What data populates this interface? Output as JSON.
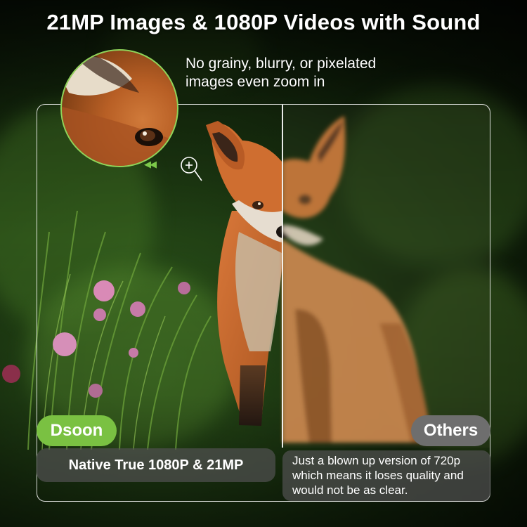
{
  "headline": "21MP Images & 1080P Videos with Sound",
  "subline": [
    "No grainy, blurry, or pixelated",
    "images even zoom in"
  ],
  "labels": {
    "left_brand": "Dsoon",
    "right_brand": "Others",
    "left_caption": "Native True 1080P & 21MP",
    "right_caption": [
      "Just a blown up version of 720p",
      "which means it loses quality and",
      "would not be as clear."
    ]
  },
  "icons": {
    "zoom": "magnifier-plus-icon",
    "arrows": "double-chevron-left-icon"
  },
  "colors": {
    "accent_green": "#7ac142",
    "others_gray": "#6e6e6e",
    "fox_orange": "#c8642a"
  }
}
